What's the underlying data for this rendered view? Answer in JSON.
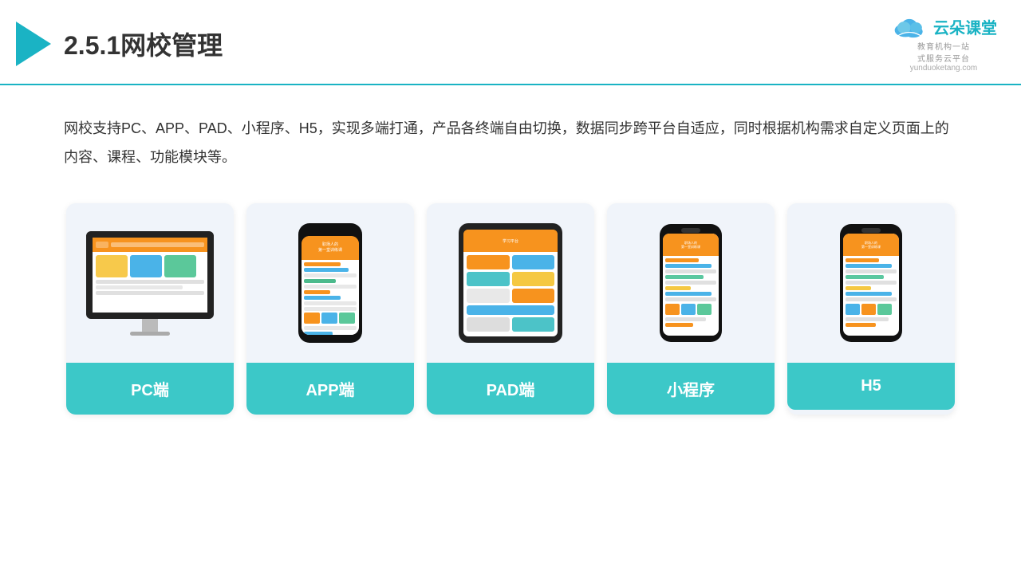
{
  "header": {
    "title_prefix": "2.5.1",
    "title_main": "网校管理",
    "logo_text": "云朵课堂",
    "logo_domain": "yunduoketang.com",
    "logo_sub": "教育机构一站\n式服务云平台"
  },
  "description": {
    "text": "网校支持PC、APP、PAD、小程序、H5，实现多端打通，产品各终端自由切换，数据同步跨平台自适应，同时根据机构需求自定义页面上的内容、课程、功能模块等。"
  },
  "cards": [
    {
      "id": "pc",
      "label": "PC端"
    },
    {
      "id": "app",
      "label": "APP端"
    },
    {
      "id": "pad",
      "label": "PAD端"
    },
    {
      "id": "mini",
      "label": "小程序"
    },
    {
      "id": "h5",
      "label": "H5"
    }
  ],
  "accent_color": "#3cc8c8"
}
